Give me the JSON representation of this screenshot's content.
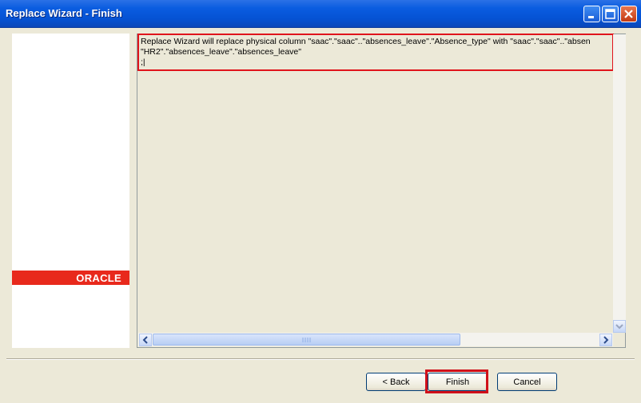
{
  "window": {
    "title": "Replace Wizard - Finish"
  },
  "branding": {
    "logo_text": "ORACLE"
  },
  "summary": {
    "lines": [
      "Replace Wizard will replace physical column \"saac\".\"saac\"..\"absences_leave\".\"Absence_type\" with \"saac\".\"saac\"..\"absen",
      "\"HR2\".\"absences_leave\".\"absences_leave\"",
      ";|"
    ]
  },
  "buttons": {
    "back_label": "< Back",
    "finish_label": "Finish",
    "cancel_label": "Cancel"
  },
  "colors": {
    "titlebar": "#0552d3",
    "oracle_red": "#e8291c",
    "highlight_red": "#e0141c"
  }
}
